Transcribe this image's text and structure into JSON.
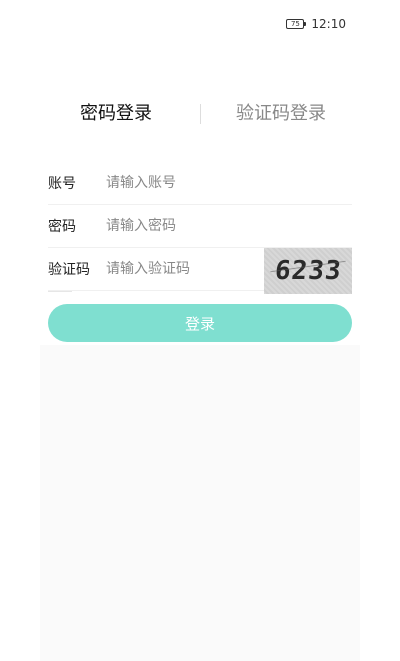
{
  "status_bar": {
    "battery_level": "75",
    "time": "12:10"
  },
  "tabs": {
    "password_login": "密码登录",
    "sms_login": "验证码登录",
    "active": "password_login"
  },
  "form": {
    "account": {
      "label": "账号",
      "placeholder": "请输入账号",
      "value": ""
    },
    "password": {
      "label": "密码",
      "placeholder": "请输入密码",
      "value": ""
    },
    "captcha": {
      "label": "验证码",
      "placeholder": "请输入验证码",
      "value": "",
      "image_text": "6233"
    }
  },
  "login_button": {
    "label": "登录"
  },
  "colors": {
    "accent": "#7fdfd0",
    "active_tab": "#111111",
    "inactive_tab": "#888888"
  }
}
